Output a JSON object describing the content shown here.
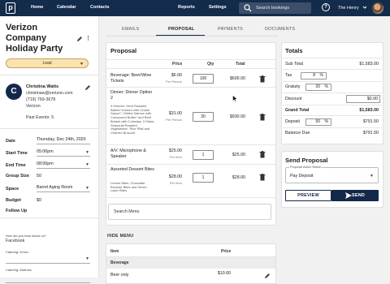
{
  "topbar": {
    "logo": "p",
    "nav": [
      "Home",
      "Calendar",
      "Contacts",
      "Reports",
      "Settings"
    ],
    "search_placeholder": "Search bookings",
    "help": "?",
    "user": "The Henry"
  },
  "event": {
    "title": "Verizon Company Holiday Party",
    "status": "Lead"
  },
  "contact": {
    "initial": "C",
    "name": "Christina Watts",
    "email": "christinaw@verizon.com",
    "phone": "(719) 769-3678",
    "company": "Verizon",
    "past_events": "Past Events: 5"
  },
  "details": [
    {
      "label": "Date",
      "value": "Thursday, Dec 24th, 2020"
    },
    {
      "label": "Start Time",
      "value": "05:00pm"
    },
    {
      "label": "End Time",
      "value": "08:00pm"
    },
    {
      "label": "Group Size",
      "value": "50"
    },
    {
      "label": "Space",
      "value": "Barrel Aging Room"
    },
    {
      "label": "Budget",
      "value": "$0"
    },
    {
      "label": "Follow Up",
      "value": ""
    }
  ],
  "extra": {
    "heard_label": "How did you hear about us?",
    "heard_value": "Facebook",
    "catering_driver_label": "Catering: Driver",
    "catering_address_label": "Catering: Address"
  },
  "tabs": [
    "EMAILS",
    "PROPOSAL",
    "PAYMENTS",
    "DOCUMENTS"
  ],
  "proposal": {
    "title": "Proposal",
    "headers": {
      "price": "Price",
      "qty": "Qty",
      "total": "Total"
    },
    "items": [
      {
        "name": "Beverage: Beer/Wine Tickets",
        "desc": "",
        "price": "$6.00",
        "unit": "Per Person",
        "qty": "100",
        "total": "$600.00"
      },
      {
        "name": "Dinner: Dinner Option 2",
        "desc": "3 Entrees: Herb Roasted Baked Chicken with Cream Sauce*, Chilled Salmon with Compound Butter* and Beef Brisket with Coleslaw. 3 Sides: Seasonal Roasted Vegetables*, Rice Pilaf and Charred Broccoli.",
        "price": "$31.00",
        "unit": "Per Person",
        "qty": "30",
        "total": "$930.00"
      },
      {
        "name": "A/V: Microphone & Speaker",
        "desc": "",
        "price": "$25.00",
        "unit": "Per Item",
        "qty": "1",
        "total": "$25.00"
      },
      {
        "name": "Assorted Dessert Bites",
        "desc": "Lemon Bites, Chocolate Brownie Bites and Seven Layer Bites",
        "price": "$28.00",
        "unit": "Per Item",
        "qty": "1",
        "total": "$28.00"
      }
    ],
    "search_menu": "Search Menu"
  },
  "menu": {
    "hide_label": "HIDE MENU",
    "item_header": "Item",
    "price_header": "Price",
    "category": "Beverage",
    "first_item": "Beer only",
    "first_price": "$10.00"
  },
  "totals": {
    "title": "Totals",
    "subtotal_label": "Sub Total",
    "subtotal": "$1,583.00",
    "tax_label": "Tax",
    "tax_rate": "8",
    "tax": "$126.64",
    "gratuity_label": "Gratuity",
    "gratuity_rate": "20",
    "gratuity": "$316.60",
    "discount_label": "Discount",
    "discount": "$0.00",
    "grand_label": "Grand Total",
    "grand": "$1,583.00",
    "deposit_label": "Deposit",
    "deposit_rate": "50",
    "deposit": "$791.50",
    "balance_label": "Balance Due",
    "balance": "$791.50",
    "pct": "%"
  },
  "send": {
    "title": "Send Proposal",
    "select_label": "Proposal Action Button",
    "select_value": "Pay Deposit",
    "preview": "PREVIEW",
    "send": "SEND"
  }
}
